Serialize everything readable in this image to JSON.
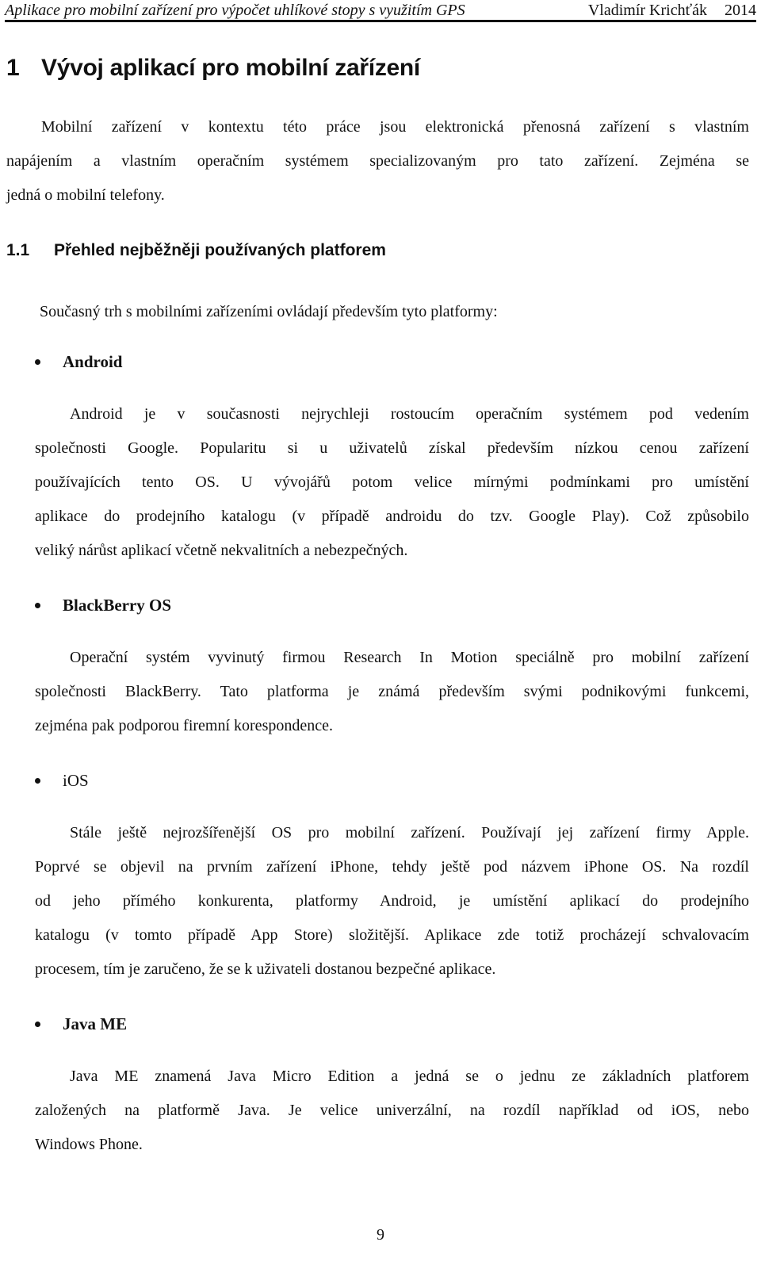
{
  "header": {
    "title": "Aplikace pro mobilní zařízení pro výpočet uhlíkové stopy s využitím GPS",
    "author": "Vladimír Krichťák",
    "year": "2014"
  },
  "chapter": {
    "number": "1",
    "title": "Vývoj aplikací pro mobilní zařízení",
    "intro_lines": [
      "Mobilní zařízení v kontextu této práce jsou elektronická přenosná zařízení s vlastním",
      "napájením a vlastním operačním systémem specializovaným pro tato zařízení. Zejména se",
      "jedná o mobilní telefony."
    ]
  },
  "section": {
    "number": "1.1",
    "title": "Přehled nejběžněji používaných platforem",
    "intro": "Současný trh s mobilními zařízeními ovládají především tyto platformy:"
  },
  "platforms": [
    {
      "name": "Android",
      "lines": [
        "Android je v současnosti nejrychleji rostoucím operačním systémem pod vedením",
        "společnosti Google. Popularitu si u uživatelů získal především nízkou cenou zařízení",
        "používajících tento OS. U vývojářů potom velice mírnými podmínkami pro umístění",
        "aplikace do prodejního katalogu (v případě androidu do tzv. Google Play). Což způsobilo",
        "veliký nárůst aplikací včetně nekvalitních a nebezpečných."
      ]
    },
    {
      "name": "BlackBerry OS",
      "lines": [
        "Operační systém vyvinutý firmou Research In Motion speciálně pro mobilní zařízení",
        "společnosti BlackBerry. Tato platforma je známá především svými podnikovými funkcemi,",
        "zejména pak podporou firemní korespondence."
      ]
    },
    {
      "name": "iOS",
      "lines": [
        "Stále ještě nejrozšířenější OS pro mobilní zařízení. Používají jej zařízení firmy Apple.",
        "Poprvé se objevil na prvním zařízení iPhone, tehdy ještě pod názvem iPhone OS. Na rozdíl",
        "od jeho přímého konkurenta, platformy Android, je umístění aplikací do prodejního",
        "katalogu (v tomto případě App Store) složitější. Aplikace zde totiž procházejí schvalovacím",
        "procesem, tím je zaručeno, že se k uživateli dostanou bezpečné aplikace."
      ]
    },
    {
      "name": "Java ME",
      "lines": [
        "Java ME znamená Java Micro Edition a jedná se o jednu ze základních platforem",
        "založených na platformě Java. Je velice univerzální, na rozdíl například od iOS, nebo",
        "Windows Phone."
      ]
    }
  ],
  "footer": {
    "page_number": "9"
  }
}
